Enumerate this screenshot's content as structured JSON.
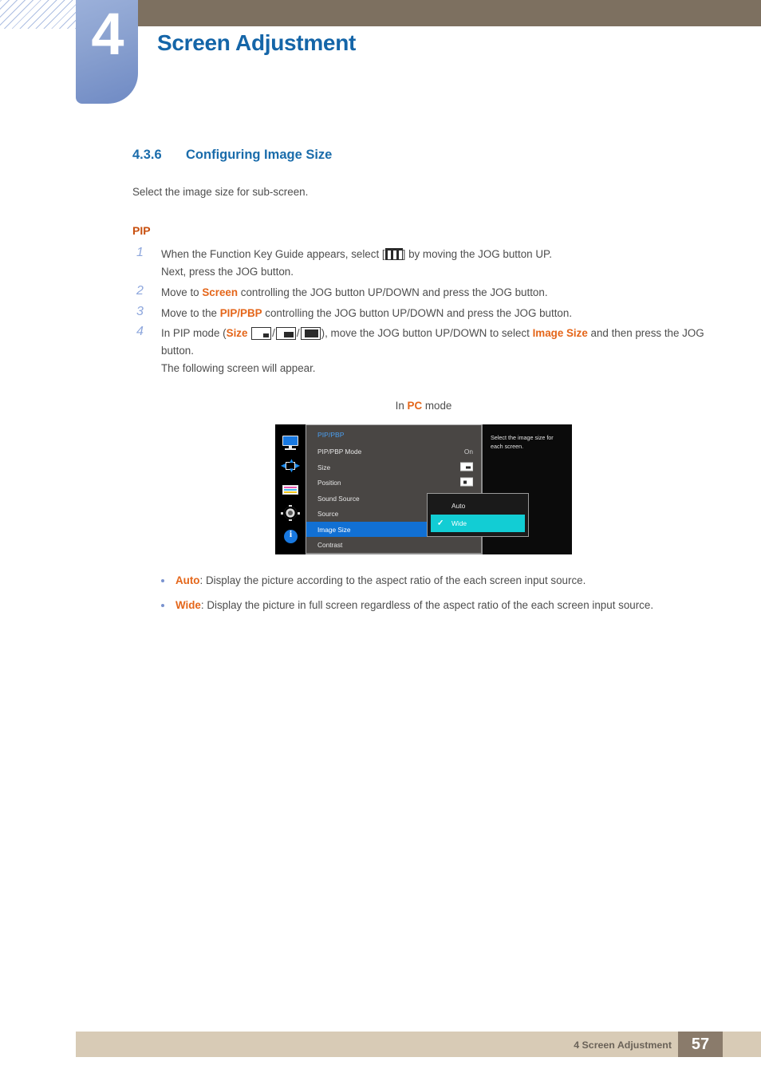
{
  "chapter": {
    "number": "4",
    "title": "Screen Adjustment"
  },
  "section": {
    "number": "4.3.6",
    "title": "Configuring Image Size",
    "intro": "Select the image size for sub-screen.",
    "subhead": "PIP"
  },
  "steps": [
    {
      "marker": "1",
      "line1_a": "When the Function Key Guide appears, select [",
      "line1_b": "] by moving the JOG button UP.",
      "line2": "Next, press the JOG button."
    },
    {
      "marker": "2",
      "pre": "Move to ",
      "kw": "Screen",
      "post": " controlling the JOG button UP/DOWN and press the JOG button."
    },
    {
      "marker": "3",
      "pre": "Move to the ",
      "kw": "PIP/PBP",
      "post": " controlling the JOG button UP/DOWN and press the JOG button."
    },
    {
      "marker": "4",
      "pre": "In PIP mode (",
      "kw": "Size",
      "mid": "), move the JOG button UP/DOWN to select ",
      "kw2": "Image Size",
      "post": " and then press the JOG button.",
      "extra": "The following screen will appear."
    }
  ],
  "caption": {
    "pre": "In ",
    "kw": "PC",
    "post": " mode"
  },
  "osd": {
    "title": "PIP/PBP",
    "hint": "Select the image size for each screen.",
    "sidebar_icons": [
      "monitor-icon",
      "position-move-icon",
      "color-bars-icon",
      "gear-icon",
      "info-icon"
    ],
    "rows": [
      {
        "label": "PIP/PBP Mode",
        "value": "On",
        "value_type": "text",
        "selected": false
      },
      {
        "label": "Size",
        "value": "",
        "value_type": "box1",
        "selected": false
      },
      {
        "label": "Position",
        "value": "",
        "value_type": "box2",
        "selected": false
      },
      {
        "label": "Sound Source",
        "value": "",
        "value_type": "box3",
        "selected": false
      },
      {
        "label": "Source",
        "value": "",
        "value_type": "none",
        "selected": false
      },
      {
        "label": "Image Size",
        "value": "",
        "value_type": "none",
        "selected": true
      },
      {
        "label": "Contrast",
        "value": "",
        "value_type": "none",
        "selected": false
      }
    ],
    "dropdown": {
      "items": [
        {
          "label": "Auto",
          "checked": false
        },
        {
          "label": "Wide",
          "checked": true
        }
      ],
      "check_glyph": "✓"
    }
  },
  "bullets": [
    {
      "term": "Auto",
      "desc": ": Display the picture according to the aspect ratio of the each screen input source."
    },
    {
      "term": "Wide",
      "desc": ": Display the picture in full screen regardless of the aspect ratio of the each screen input source."
    }
  ],
  "footer": {
    "text": "4 Screen Adjustment",
    "page": "57"
  },
  "colors": {
    "heading_blue": "#1a6cab",
    "keyword_orange": "#e4661a",
    "subhead_orange": "#c8500f",
    "header_brown": "#7d7060",
    "footer_tan": "#d8cbb6",
    "footer_page_brown": "#8a7b6b",
    "tab_blue": "#8ba2d0",
    "osd_select_blue": "#1170d4",
    "osd_highlight_teal": "#12cdd4"
  }
}
